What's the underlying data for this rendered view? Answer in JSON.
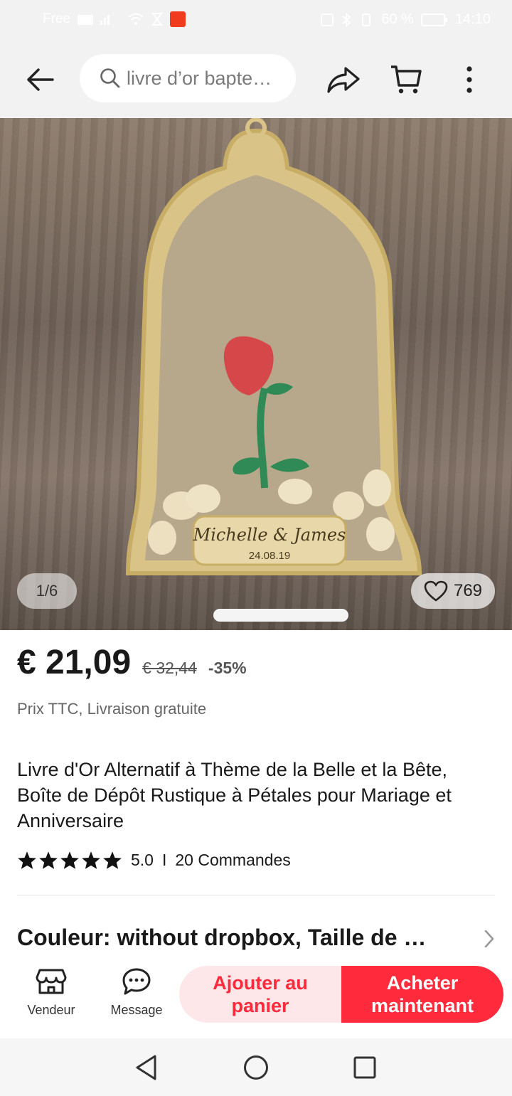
{
  "status_bar": {
    "carrier": "Free",
    "battery": "60 %",
    "time": "14:10"
  },
  "header": {
    "search_placeholder": "livre d’or bapte…",
    "icons": [
      "back-arrow-icon",
      "search-icon",
      "share-icon",
      "cart-icon",
      "more-vertical-icon"
    ]
  },
  "gallery": {
    "pager": "1/6",
    "likes": "769",
    "plaque_names": "Michelle & James",
    "plaque_date": "24.08.19"
  },
  "pricing": {
    "price": "€ 21,09",
    "old_price": "€ 32,44",
    "discount": "-35%",
    "tax_note": "Prix TTC, Livraison gratuite"
  },
  "product": {
    "title": "Livre d'Or Alternatif à Thème de la Belle et la Bête, Boîte de Dépôt Rustique à Pétales pour Mariage et Anniversaire",
    "rating": "5.0",
    "separator": "I",
    "orders": "20 Commandes",
    "stars": 5,
    "variant": "Couleur: without dropbox, Taille de …"
  },
  "actions": {
    "store_label": "Vendeur",
    "message_label": "Message",
    "add_to_cart": "Ajouter au panier",
    "buy_now": "Acheter maintenant"
  },
  "colors": {
    "accent": "#ff2a3c",
    "accent_light": "#fde7e9"
  }
}
